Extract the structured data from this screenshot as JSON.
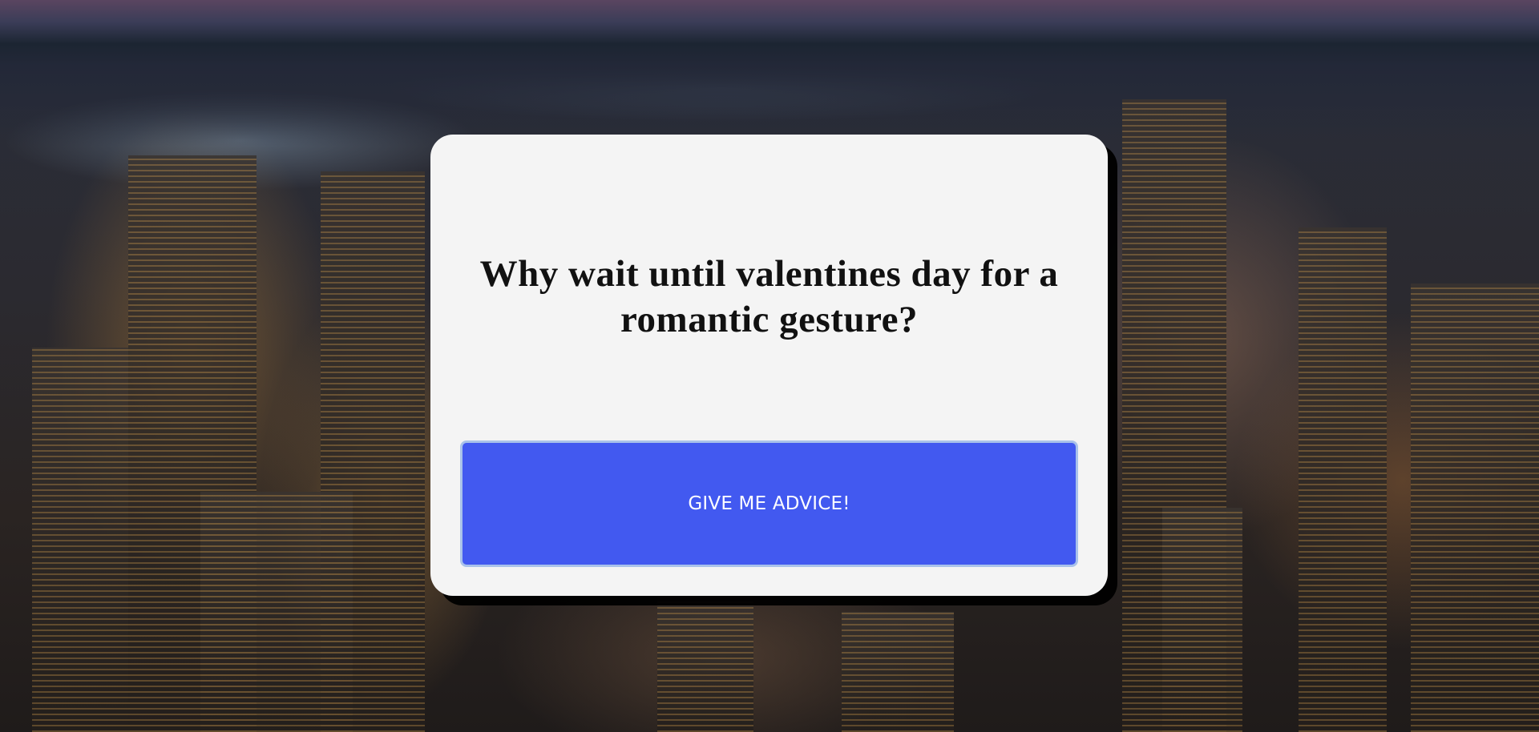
{
  "prompt": {
    "question": "Why wait until valentines day for a romantic gesture?",
    "button_label": "GIVE ME ADVICE!"
  },
  "colors": {
    "card_background": "#f4f4f4",
    "button_background": "#4259f0",
    "button_border": "#a9c2ea",
    "button_text": "#ffffff",
    "title_text": "#111111"
  }
}
